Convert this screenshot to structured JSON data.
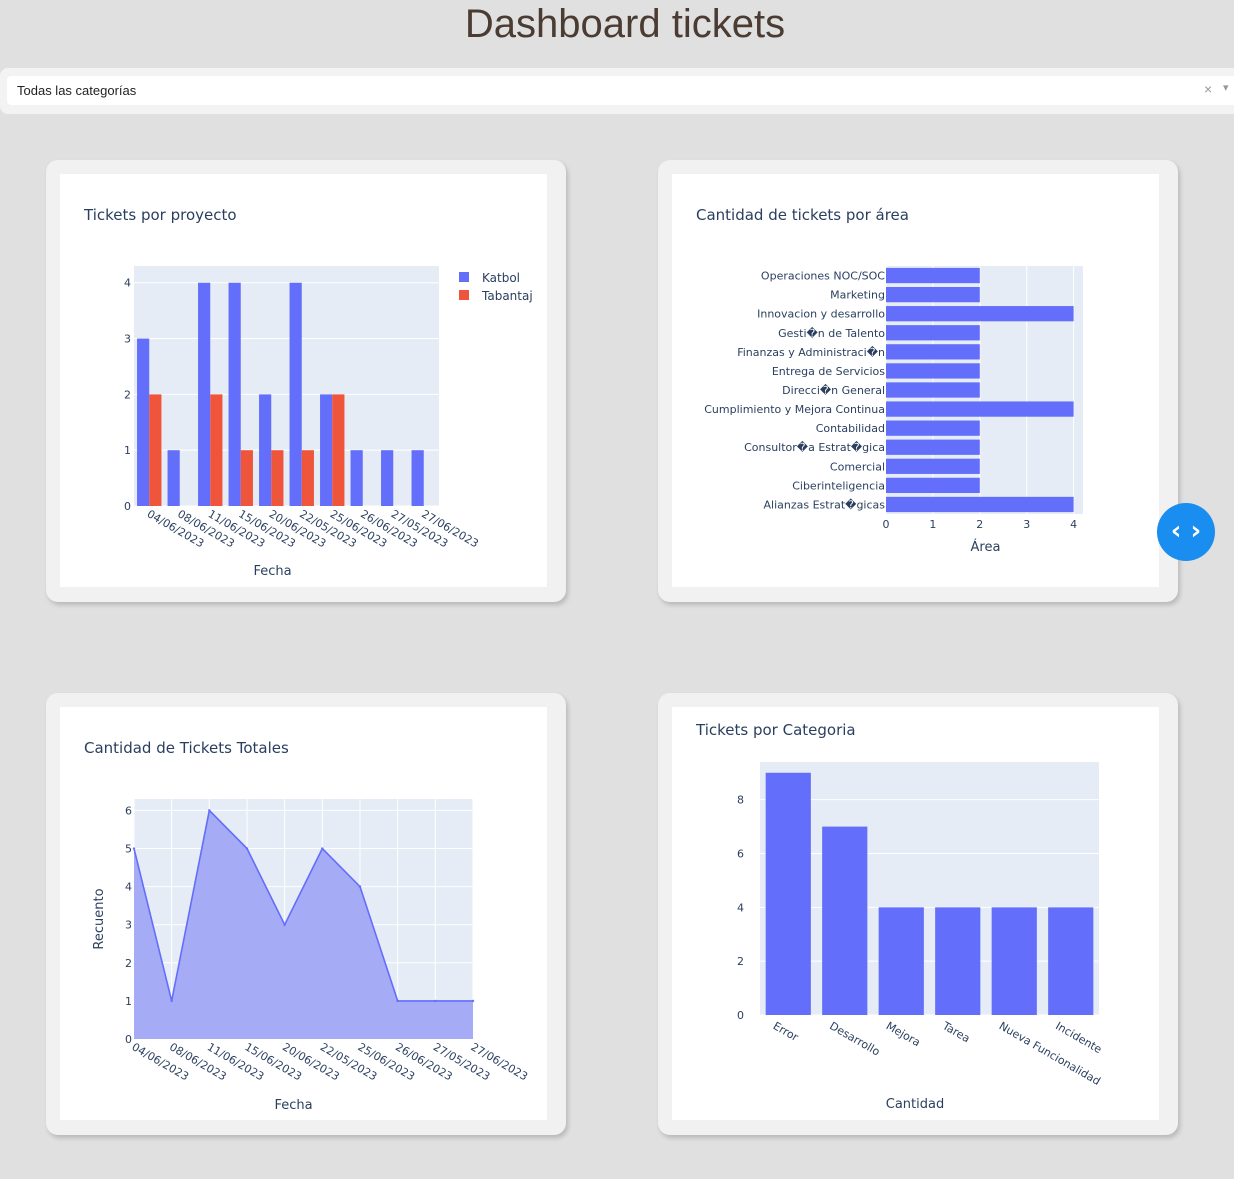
{
  "page": {
    "title": "Dashboard tickets"
  },
  "filter": {
    "value": "Todas las categorías",
    "clear_icon": "×",
    "caret_icon": "▾"
  },
  "nav_toggle": {
    "icon": "code-brackets-icon",
    "label": "‹ ›",
    "color": "#1a8df0"
  },
  "colors": {
    "primary": "#636efa",
    "secondary": "#ef553b",
    "plot_bg": "#e5ecf6",
    "area_fill": "#a5abf5"
  },
  "chart_data": [
    {
      "type": "bar",
      "title": "Tickets por proyecto",
      "xlabel": "Fecha",
      "ylabel": "",
      "ylim": [
        0,
        4.3
      ],
      "yticks": [
        "0",
        "1",
        "2",
        "3",
        "4"
      ],
      "categories": [
        "04/06/2023",
        "08/06/2023",
        "11/06/2023",
        "15/06/2023",
        "20/06/2023",
        "22/05/2023",
        "25/06/2023",
        "26/06/2023",
        "27/05/2023",
        "27/06/2023"
      ],
      "series": [
        {
          "name": "Katbol",
          "color": "#636efa",
          "values": [
            3,
            1,
            4,
            4,
            2,
            4,
            2,
            1,
            1,
            1
          ]
        },
        {
          "name": "Tabantaj",
          "color": "#ef553b",
          "values": [
            2,
            0,
            2,
            1,
            1,
            1,
            2,
            0,
            0,
            0
          ]
        }
      ],
      "legend": "top-right",
      "grid": true
    },
    {
      "type": "bar",
      "orientation": "horizontal",
      "title": "Cantidad de tickets por área",
      "xlabel": "Área",
      "ylabel": "",
      "xlim": [
        0,
        4.2
      ],
      "xticks": [
        "0",
        "1",
        "2",
        "3",
        "4"
      ],
      "categories": [
        "Operaciones NOC/SOC",
        "Marketing",
        "Innovacion y desarrollo",
        "Gesti�n de Talento",
        "Finanzas y Administraci�n",
        "Entrega de Servicios",
        "Direcci�n General",
        "Cumplimiento y Mejora Continua",
        "Contabilidad",
        "Consultor�a Estrat�gica",
        "Comercial",
        "Ciberinteligencia",
        "Alianzas Estrat�gicas"
      ],
      "values": [
        2,
        2,
        4,
        2,
        2,
        2,
        2,
        4,
        2,
        2,
        2,
        2,
        4
      ],
      "grid": true
    },
    {
      "type": "area",
      "title": "Cantidad de Tickets Totales",
      "xlabel": "Fecha",
      "ylabel": "Recuento",
      "ylim": [
        0,
        6.3
      ],
      "yticks": [
        "0",
        "1",
        "2",
        "3",
        "4",
        "5",
        "6"
      ],
      "x": [
        "04/06/2023",
        "08/06/2023",
        "11/06/2023",
        "15/06/2023",
        "20/06/2023",
        "22/05/2023",
        "25/06/2023",
        "26/06/2023",
        "27/05/2023",
        "27/06/2023"
      ],
      "values": [
        5,
        1,
        6,
        5,
        3,
        5,
        4,
        1,
        1,
        1
      ],
      "grid": true
    },
    {
      "type": "bar",
      "title": "Tickets por Categoria",
      "xlabel": "Cantidad",
      "ylabel": "",
      "ylim": [
        0,
        9.4
      ],
      "yticks": [
        "0",
        "2",
        "4",
        "6",
        "8"
      ],
      "categories": [
        "Error",
        "Desarrollo",
        "Mejora",
        "Tarea",
        "Nueva Funcionalidad",
        "Incidente"
      ],
      "values": [
        9,
        7,
        4,
        4,
        4,
        4
      ],
      "grid": true
    }
  ]
}
